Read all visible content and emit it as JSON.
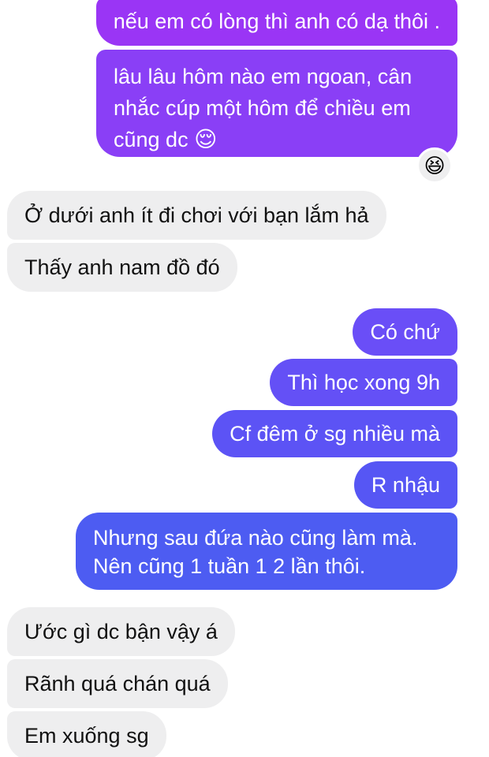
{
  "colors": {
    "purple_top": "#9a35f5",
    "purple_mid": "#8a3ff6",
    "violet": "#6a4ef7",
    "blue": "#5a57f4",
    "blue_deep": "#4d5cf2",
    "incoming_bg": "#eeeeef"
  },
  "messages": [
    {
      "id": "m1",
      "side": "outgoing",
      "text": "nếu em có lòng thì anh có dạ thôi ."
    },
    {
      "id": "m2",
      "side": "outgoing",
      "text": "lâu lâu hôm nào em ngoan, cân nhắc cúp một hôm để chiều em cũng dc",
      "emoji": "😌",
      "emoji_name": "relieved-face-icon",
      "reaction": "😆",
      "reaction_name": "laughing-face-icon"
    },
    {
      "id": "m3",
      "side": "incoming",
      "text": "Ở dưới anh ít đi chơi với bạn lắm hả"
    },
    {
      "id": "m4",
      "side": "incoming",
      "text": "Thấy anh nam đồ đó"
    },
    {
      "id": "m5",
      "side": "outgoing",
      "text": "Có chứ"
    },
    {
      "id": "m6",
      "side": "outgoing",
      "text": "Thì học xong 9h"
    },
    {
      "id": "m7",
      "side": "outgoing",
      "text": "Cf đêm ở sg nhiều mà"
    },
    {
      "id": "m8",
      "side": "outgoing",
      "text": "R nhậu"
    },
    {
      "id": "m9",
      "side": "outgoing",
      "line1": "Nhưng sau đứa nào cũng làm mà.",
      "line2": "Nên cũng 1 tuần 1 2 lần thôi."
    },
    {
      "id": "m10",
      "side": "incoming",
      "text": "Ước gì dc bận vậy á"
    },
    {
      "id": "m11",
      "side": "incoming",
      "text": "Rãnh quá chán quá"
    },
    {
      "id": "m12",
      "side": "incoming",
      "text": "Em xuống sg"
    }
  ]
}
